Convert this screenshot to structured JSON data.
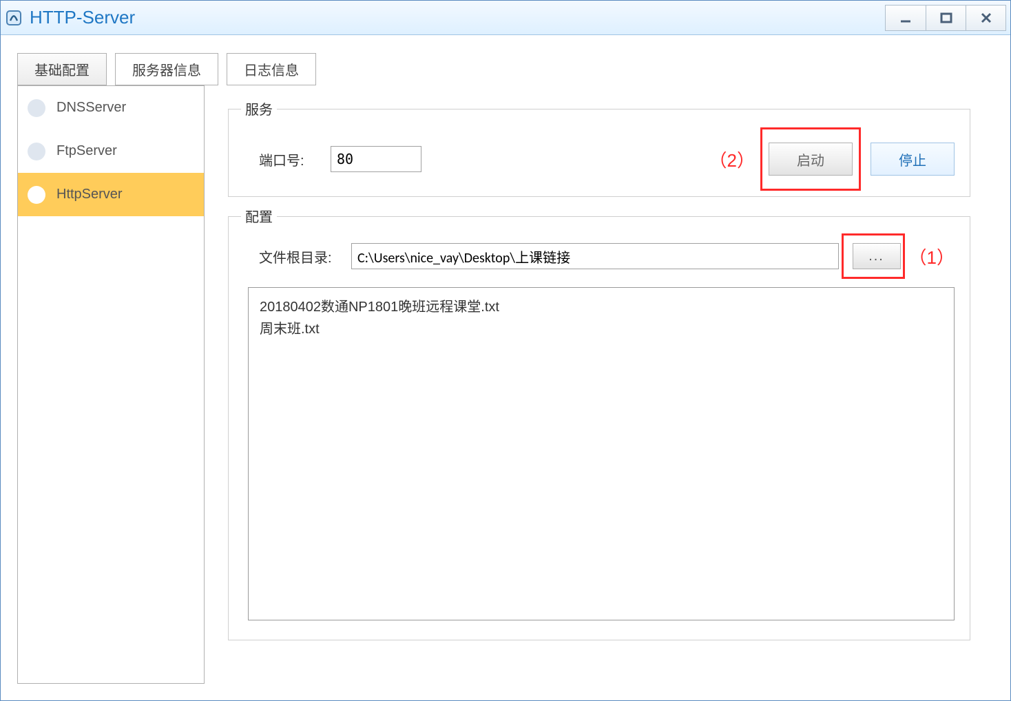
{
  "window": {
    "title": "HTTP-Server"
  },
  "tabs": [
    {
      "label": "基础配置",
      "active": true
    },
    {
      "label": "服务器信息",
      "active": false
    },
    {
      "label": "日志信息",
      "active": false
    }
  ],
  "sidebar": {
    "items": [
      {
        "label": "DNSServer",
        "selected": false
      },
      {
        "label": "FtpServer",
        "selected": false
      },
      {
        "label": "HttpServer",
        "selected": true
      }
    ]
  },
  "service": {
    "legend": "服务",
    "port_label": "端口号:",
    "port_value": "80",
    "start_label": "启动",
    "stop_label": "停止"
  },
  "config": {
    "legend": "配置",
    "root_label": "文件根目录:",
    "root_value": "C:\\Users\\nice_vay\\Desktop\\上课链接",
    "browse_label": "...",
    "files": [
      "20180402数通NP1801晚班远程课堂.txt",
      "周末班.txt"
    ]
  },
  "annotations": {
    "a1": "（1）",
    "a2": "（2）"
  }
}
